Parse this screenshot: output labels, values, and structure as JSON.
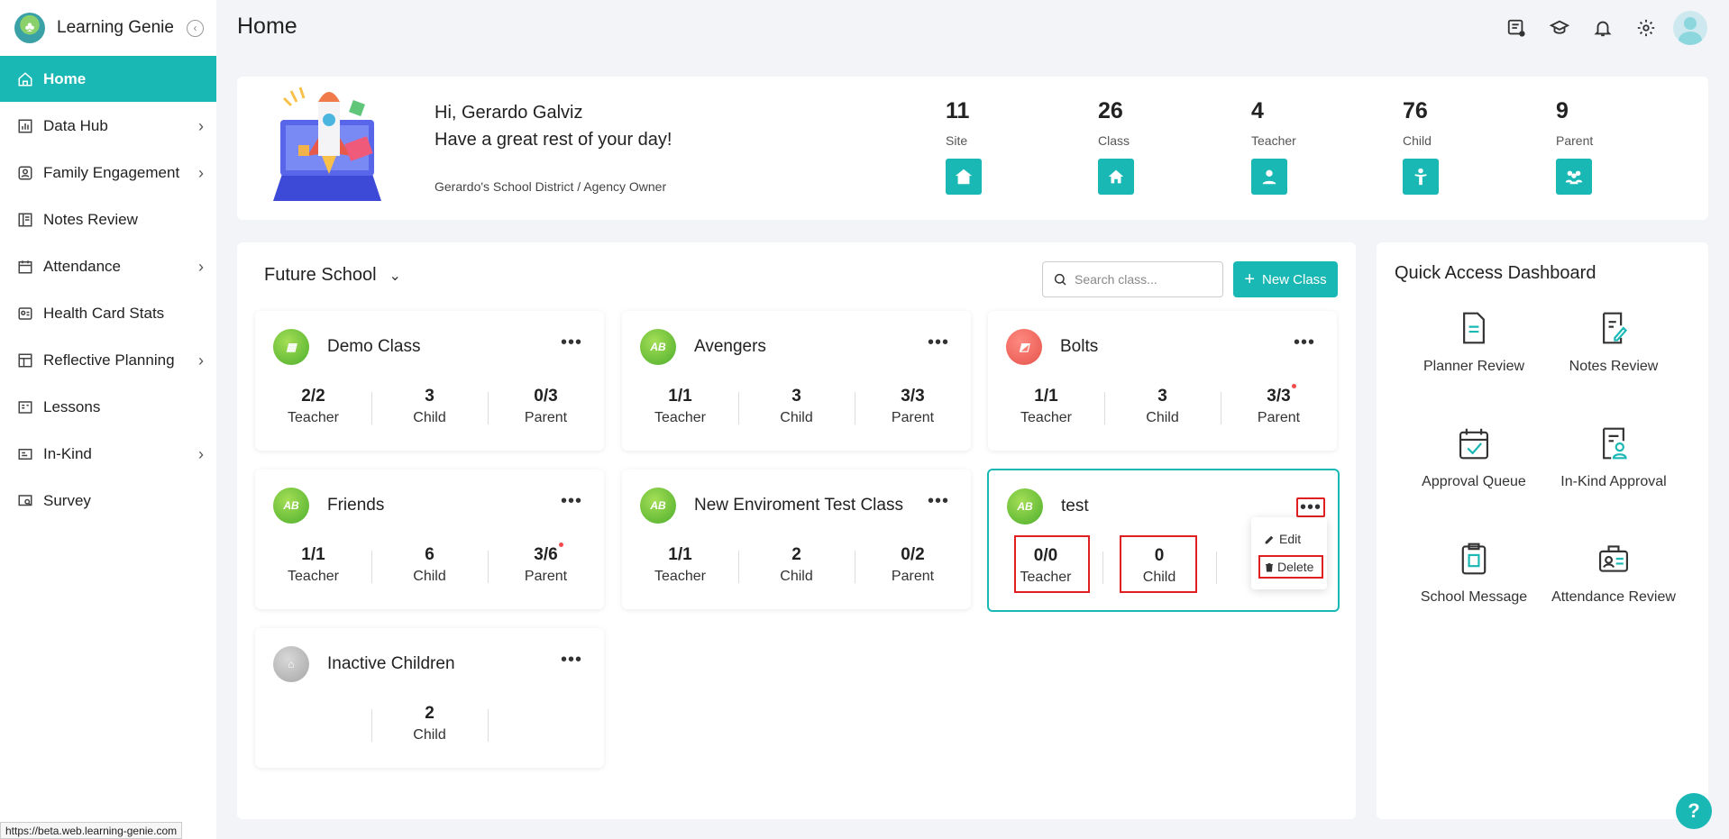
{
  "app": {
    "name": "Learning Genie",
    "page_title": "Home"
  },
  "sidebar": {
    "items": [
      {
        "label": "Home",
        "icon": "home-icon",
        "active": true,
        "has_children": false
      },
      {
        "label": "Data Hub",
        "icon": "chart-icon",
        "has_children": true
      },
      {
        "label": "Family Engagement",
        "icon": "family-icon",
        "has_children": true
      },
      {
        "label": "Notes Review",
        "icon": "notes-icon",
        "has_children": false
      },
      {
        "label": "Attendance",
        "icon": "calendar-icon",
        "has_children": true
      },
      {
        "label": "Health Card Stats",
        "icon": "health-card-icon",
        "has_children": false
      },
      {
        "label": "Reflective Planning",
        "icon": "planning-icon",
        "has_children": true
      },
      {
        "label": "Lessons",
        "icon": "lessons-icon",
        "has_children": false
      },
      {
        "label": "In-Kind",
        "icon": "in-kind-icon",
        "has_children": true
      },
      {
        "label": "Survey",
        "icon": "survey-icon",
        "has_children": false
      }
    ]
  },
  "banner": {
    "greeting": "Hi, Gerardo Galviz",
    "message": "Have a great rest of your day!",
    "role": "Gerardo's School District / Agency Owner",
    "stats": [
      {
        "value": "11",
        "label": "Site"
      },
      {
        "value": "26",
        "label": "Class"
      },
      {
        "value": "4",
        "label": "Teacher"
      },
      {
        "value": "76",
        "label": "Child"
      },
      {
        "value": "9",
        "label": "Parent"
      }
    ]
  },
  "classes": {
    "school": "Future School",
    "search_placeholder": "Search class...",
    "new_class_label": "New Class",
    "cards": [
      {
        "name": "Demo Class",
        "teacher": "2/2",
        "child": "3",
        "parent": "0/3"
      },
      {
        "name": "Avengers",
        "teacher": "1/1",
        "child": "3",
        "parent": "3/3"
      },
      {
        "name": "Bolts",
        "teacher": "1/1",
        "child": "3",
        "parent": "3/3"
      },
      {
        "name": "Friends",
        "teacher": "1/1",
        "child": "6",
        "parent": "3/6"
      },
      {
        "name": "New Enviroment Test Class",
        "teacher": "1/1",
        "child": "2",
        "parent": "0/2"
      },
      {
        "name": "test",
        "teacher": "0/0",
        "child": "0"
      },
      {
        "name": "Inactive Children",
        "child": "2"
      }
    ],
    "stat_labels": {
      "teacher": "Teacher",
      "child": "Child",
      "parent": "Parent"
    },
    "menu": {
      "edit": "Edit",
      "delete": "Delete"
    }
  },
  "quick_access": {
    "title": "Quick Access Dashboard",
    "items": [
      {
        "label": "Planner Review",
        "icon": "planner-review-icon"
      },
      {
        "label": "Notes Review",
        "icon": "notes-review-icon"
      },
      {
        "label": "Approval Queue",
        "icon": "approval-queue-icon"
      },
      {
        "label": "In-Kind Approval",
        "icon": "in-kind-approval-icon"
      },
      {
        "label": "School Message",
        "icon": "school-message-icon"
      },
      {
        "label": "Attendance Review",
        "icon": "attendance-review-icon"
      }
    ]
  },
  "status_bar": {
    "url": "https://beta.web.learning-genie.com"
  },
  "help": "?",
  "colors": {
    "accent": "#1ab8b5",
    "highlight": "#e02020"
  }
}
